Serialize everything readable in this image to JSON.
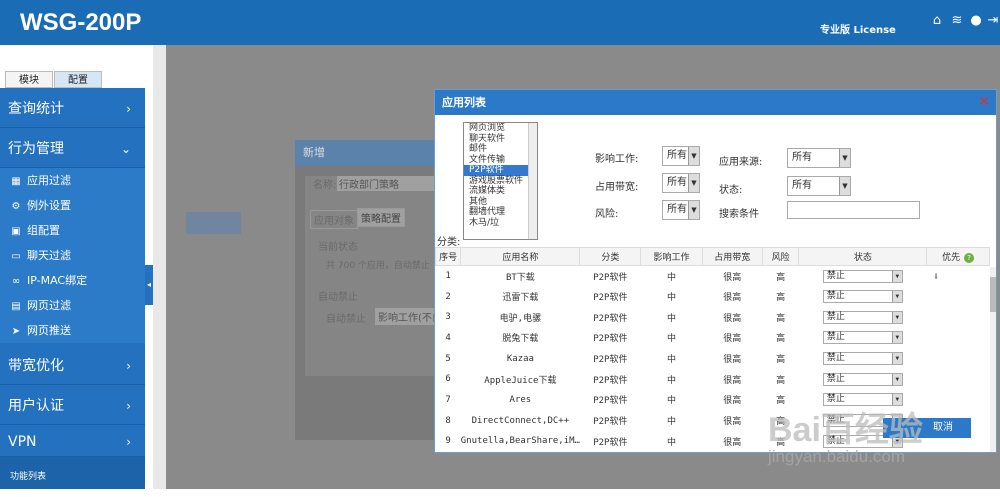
{
  "header": {
    "logo": "WSG-200P",
    "edition": "专业版 License"
  },
  "sidebar": {
    "tabs": [
      "模块",
      "配置"
    ],
    "sections": [
      {
        "label": "查询统计",
        "chevron": "›"
      },
      {
        "label": "行为管理",
        "chevron": "⌄"
      },
      {
        "label": "带宽优化",
        "chevron": "›"
      },
      {
        "label": "用户认证",
        "chevron": "›"
      },
      {
        "label": "VPN",
        "chevron": "›"
      }
    ],
    "items": [
      {
        "label": "应用过滤",
        "icon": "grid-icon"
      },
      {
        "label": "例外设置",
        "icon": "gear-icon"
      },
      {
        "label": "组配置",
        "icon": "group-icon"
      },
      {
        "label": "聊天过滤",
        "icon": "chat-icon"
      },
      {
        "label": "IP-MAC绑定",
        "icon": "link-icon"
      },
      {
        "label": "网页过滤",
        "icon": "page-icon"
      },
      {
        "label": "网页推送",
        "icon": "send-icon"
      }
    ],
    "footer": "功能列表"
  },
  "background": {
    "new_dialog_title": "新增",
    "name_label": "名称:",
    "name_value": "行政部门策略",
    "tab1": "应用对象",
    "tab2": "策略配置",
    "section1": "当前状态",
    "status_text": "共 700 个应用，自动禁止",
    "section2": "自动禁止",
    "auto_label": "自动禁止",
    "auto_value": "影响工作(不自"
  },
  "modal": {
    "title": "应用列表",
    "category_label": "分类:",
    "categories": [
      "网页浏览",
      "聊天软件",
      "邮件",
      "文件传输",
      "P2P软件",
      "游戏股票软件",
      "流媒体类",
      "其他",
      "翻墙代理",
      "木马/垃"
    ],
    "selected_category": "P2P软件",
    "filters": {
      "work_label": "影响工作:",
      "work_value": "所有",
      "bandwidth_label": "占用带宽:",
      "bandwidth_value": "所有",
      "risk_label": "风险:",
      "risk_value": "所有",
      "source_label": "应用来源:",
      "source_value": "所有",
      "status_label": "状态:",
      "status_value": "所有",
      "search_label": "搜索条件",
      "search_value": ""
    },
    "columns": [
      "序号",
      "应用名称",
      "分类",
      "影响工作",
      "占用带宽",
      "风险",
      "状态",
      "优先"
    ],
    "rows": [
      {
        "no": "1",
        "name": "BT下载",
        "cat": "P2P软件",
        "work": "中",
        "bw": "很高",
        "risk": "高",
        "status": "禁止"
      },
      {
        "no": "2",
        "name": "迅雷下载",
        "cat": "P2P软件",
        "work": "中",
        "bw": "很高",
        "risk": "高",
        "status": "禁止"
      },
      {
        "no": "3",
        "name": "电驴,电骡",
        "cat": "P2P软件",
        "work": "中",
        "bw": "很高",
        "risk": "高",
        "status": "禁止"
      },
      {
        "no": "4",
        "name": "脱兔下载",
        "cat": "P2P软件",
        "work": "中",
        "bw": "很高",
        "risk": "高",
        "status": "禁止"
      },
      {
        "no": "5",
        "name": "Kazaa",
        "cat": "P2P软件",
        "work": "中",
        "bw": "很高",
        "risk": "高",
        "status": "禁止"
      },
      {
        "no": "6",
        "name": "AppleJuice下载",
        "cat": "P2P软件",
        "work": "中",
        "bw": "很高",
        "risk": "高",
        "status": "禁止"
      },
      {
        "no": "7",
        "name": "Ares",
        "cat": "P2P软件",
        "work": "中",
        "bw": "很高",
        "risk": "高",
        "status": "禁止"
      },
      {
        "no": "8",
        "name": "DirectConnect,DC++",
        "cat": "P2P软件",
        "work": "中",
        "bw": "很高",
        "risk": "高",
        "status": "禁止"
      },
      {
        "no": "9",
        "name": "Gnutella,BearShare,iM…",
        "cat": "P2P软件",
        "work": "中",
        "bw": "很高",
        "risk": "高",
        "status": "禁止"
      }
    ],
    "cancel_label": "取消"
  },
  "watermark": {
    "line1": "Bai百经验",
    "line2": "jingyan.baidu.com"
  }
}
